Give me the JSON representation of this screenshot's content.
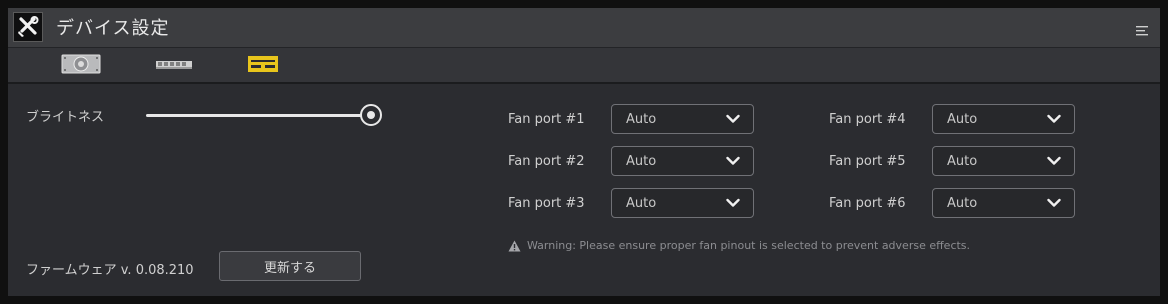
{
  "titlebar": {
    "title": "デバイス設定",
    "app_icon": "tools-icon",
    "menu_icon": "menu-icon"
  },
  "tabs": [
    {
      "name": "fan-device-tab",
      "icon": "fan-device-icon",
      "active": false
    },
    {
      "name": "memory-device-tab",
      "icon": "memory-module-icon",
      "active": false
    },
    {
      "name": "gpu-device-tab",
      "icon": "gpu-card-icon",
      "active": true
    }
  ],
  "colors": {
    "accent": "#e8c51c",
    "background": "#2b2c30",
    "titlebar": "#3c3d40"
  },
  "brightness": {
    "label": "ブライトネス",
    "value": 1.0
  },
  "firmware": {
    "label": "ファームウェア v. 0.08.210",
    "update_label": "更新する"
  },
  "fans": [
    {
      "label": "Fan port #1",
      "value": "Auto"
    },
    {
      "label": "Fan port #2",
      "value": "Auto"
    },
    {
      "label": "Fan port #3",
      "value": "Auto"
    },
    {
      "label": "Fan port #4",
      "value": "Auto"
    },
    {
      "label": "Fan port #5",
      "value": "Auto"
    },
    {
      "label": "Fan port #6",
      "value": "Auto"
    }
  ],
  "warning": {
    "icon": "warning-icon",
    "text": "Warning: Please ensure proper fan pinout is selected to prevent adverse effects."
  }
}
